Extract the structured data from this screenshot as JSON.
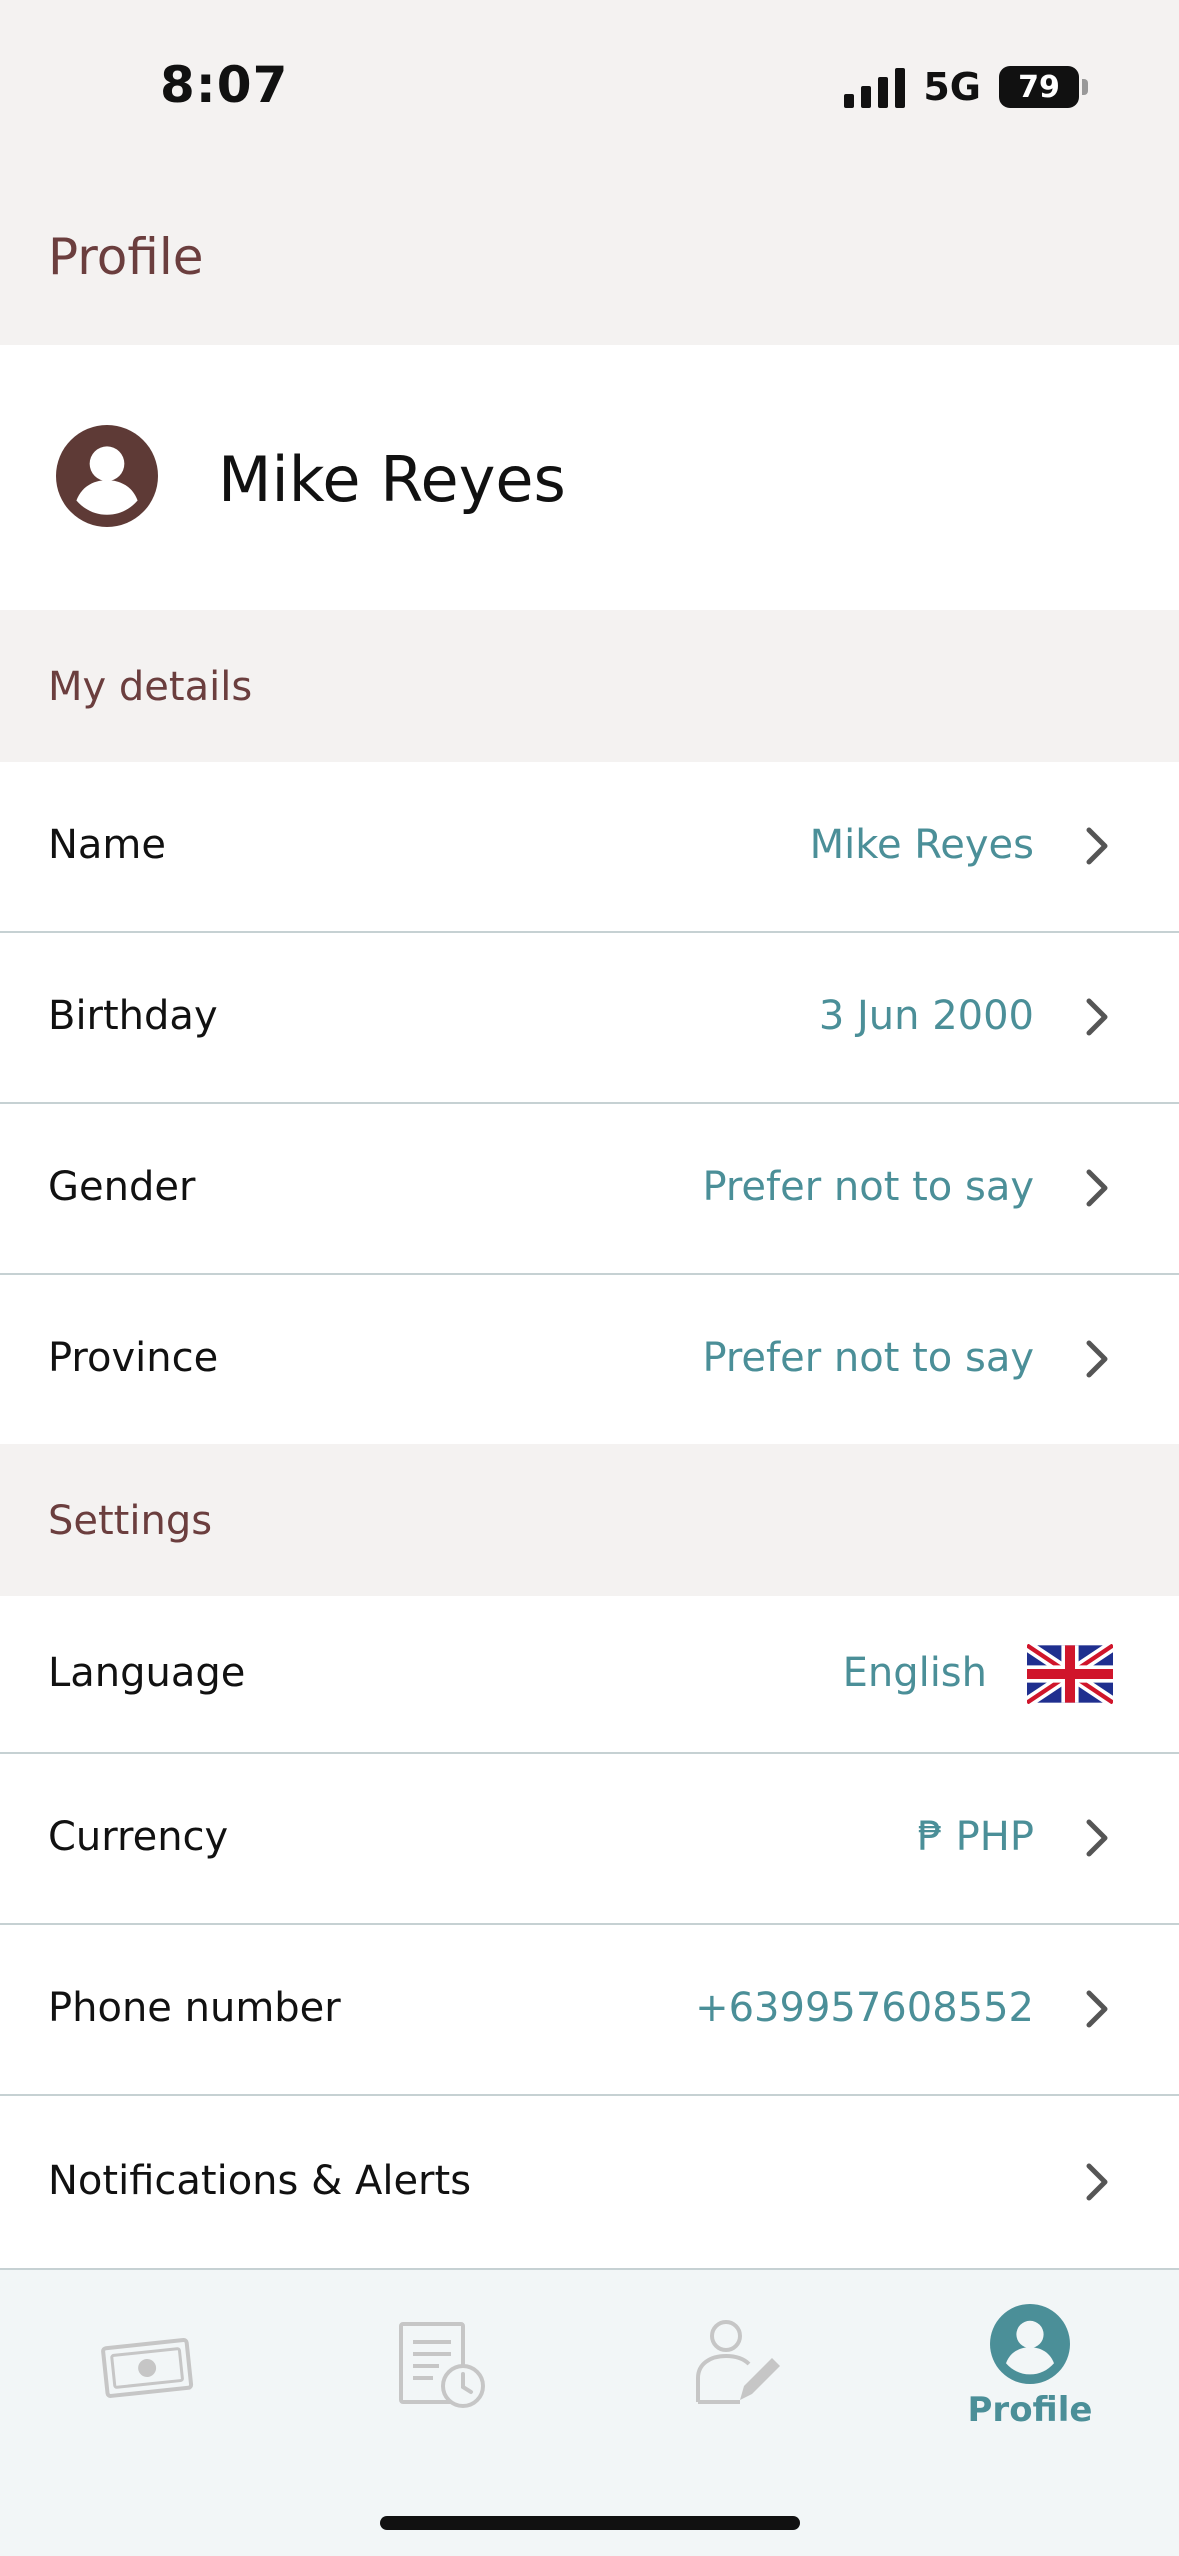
{
  "status_bar": {
    "time": "8:07",
    "network": "5G",
    "battery": "79"
  },
  "header": {
    "title": "Profile"
  },
  "profile": {
    "name": "Mike Reyes",
    "avatar_icon": "user-circle-icon"
  },
  "my_details": {
    "title": "My details",
    "rows": [
      {
        "label": "Name",
        "value": "Mike Reyes"
      },
      {
        "label": "Birthday",
        "value": "3 Jun 2000"
      },
      {
        "label": "Gender",
        "value": "Prefer not to say"
      },
      {
        "label": "Province",
        "value": "Prefer not to say"
      }
    ]
  },
  "settings": {
    "title": "Settings",
    "language": {
      "label": "Language",
      "value": "English",
      "flag_icon": "uk-flag-icon"
    },
    "rows": [
      {
        "label": "Currency",
        "value": "₱ PHP"
      },
      {
        "label": "Phone number",
        "value": "+639957608552"
      },
      {
        "label": "Notifications & Alerts",
        "value": ""
      }
    ]
  },
  "tab_bar": {
    "tabs": [
      {
        "icon": "money-icon",
        "label": ""
      },
      {
        "icon": "history-icon",
        "label": ""
      },
      {
        "icon": "edit-profile-icon",
        "label": ""
      },
      {
        "icon": "profile-icon",
        "label": "Profile",
        "active": true
      }
    ]
  },
  "colors": {
    "accent": "#4b8f98",
    "brand": "#6b3e3e",
    "background": "#f4f2f1"
  }
}
